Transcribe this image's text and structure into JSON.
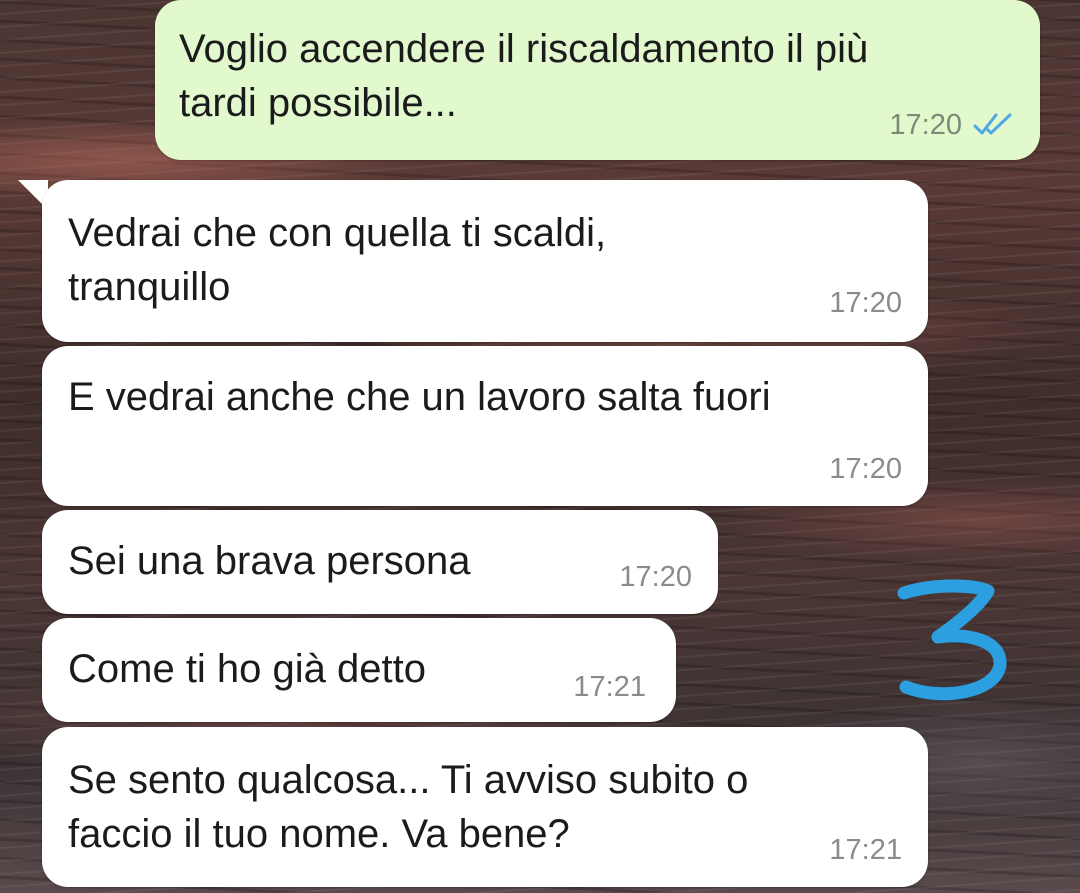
{
  "conversation": {
    "messages": [
      {
        "direction": "outgoing",
        "text": "Voglio accendere il riscaldamento il più\ntardi possibile...",
        "time": "17:20",
        "status_icon": "double-check-read-icon"
      },
      {
        "direction": "incoming",
        "text": "Vedrai che con quella ti scaldi,\ntranquillo",
        "time": "17:20"
      },
      {
        "direction": "incoming",
        "text": "E vedrai anche che un lavoro salta fuori",
        "time": "17:20"
      },
      {
        "direction": "incoming",
        "text": "Sei una brava persona",
        "time": "17:20"
      },
      {
        "direction": "incoming",
        "text": "Come ti ho già detto",
        "time": "17:21"
      },
      {
        "direction": "incoming",
        "text": "Se sento qualcosa... Ti avviso subito o\nfaccio il tuo nome. Va bene?",
        "time": "17:21"
      }
    ]
  },
  "annotation": {
    "glyph": "3",
    "color": "#2b9fe0"
  },
  "colors": {
    "outgoing_bubble": "#e2f8cd",
    "incoming_bubble": "#ffffff",
    "read_ticks": "#4fa8e6",
    "timestamp": "#8b8b8b"
  }
}
